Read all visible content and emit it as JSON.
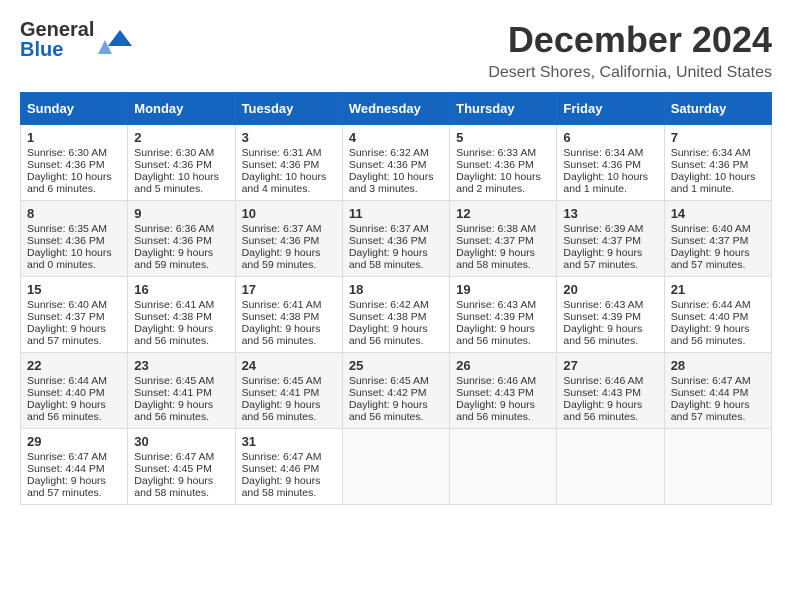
{
  "header": {
    "logo_line1": "General",
    "logo_line2": "Blue",
    "title": "December 2024",
    "subtitle": "Desert Shores, California, United States"
  },
  "weekdays": [
    "Sunday",
    "Monday",
    "Tuesday",
    "Wednesday",
    "Thursday",
    "Friday",
    "Saturday"
  ],
  "weeks": [
    [
      {
        "day": "1",
        "sunrise": "Sunrise: 6:30 AM",
        "sunset": "Sunset: 4:36 PM",
        "daylight": "Daylight: 10 hours and 6 minutes."
      },
      {
        "day": "2",
        "sunrise": "Sunrise: 6:30 AM",
        "sunset": "Sunset: 4:36 PM",
        "daylight": "Daylight: 10 hours and 5 minutes."
      },
      {
        "day": "3",
        "sunrise": "Sunrise: 6:31 AM",
        "sunset": "Sunset: 4:36 PM",
        "daylight": "Daylight: 10 hours and 4 minutes."
      },
      {
        "day": "4",
        "sunrise": "Sunrise: 6:32 AM",
        "sunset": "Sunset: 4:36 PM",
        "daylight": "Daylight: 10 hours and 3 minutes."
      },
      {
        "day": "5",
        "sunrise": "Sunrise: 6:33 AM",
        "sunset": "Sunset: 4:36 PM",
        "daylight": "Daylight: 10 hours and 2 minutes."
      },
      {
        "day": "6",
        "sunrise": "Sunrise: 6:34 AM",
        "sunset": "Sunset: 4:36 PM",
        "daylight": "Daylight: 10 hours and 1 minute."
      },
      {
        "day": "7",
        "sunrise": "Sunrise: 6:34 AM",
        "sunset": "Sunset: 4:36 PM",
        "daylight": "Daylight: 10 hours and 1 minute."
      }
    ],
    [
      {
        "day": "8",
        "sunrise": "Sunrise: 6:35 AM",
        "sunset": "Sunset: 4:36 PM",
        "daylight": "Daylight: 10 hours and 0 minutes."
      },
      {
        "day": "9",
        "sunrise": "Sunrise: 6:36 AM",
        "sunset": "Sunset: 4:36 PM",
        "daylight": "Daylight: 9 hours and 59 minutes."
      },
      {
        "day": "10",
        "sunrise": "Sunrise: 6:37 AM",
        "sunset": "Sunset: 4:36 PM",
        "daylight": "Daylight: 9 hours and 59 minutes."
      },
      {
        "day": "11",
        "sunrise": "Sunrise: 6:37 AM",
        "sunset": "Sunset: 4:36 PM",
        "daylight": "Daylight: 9 hours and 58 minutes."
      },
      {
        "day": "12",
        "sunrise": "Sunrise: 6:38 AM",
        "sunset": "Sunset: 4:37 PM",
        "daylight": "Daylight: 9 hours and 58 minutes."
      },
      {
        "day": "13",
        "sunrise": "Sunrise: 6:39 AM",
        "sunset": "Sunset: 4:37 PM",
        "daylight": "Daylight: 9 hours and 57 minutes."
      },
      {
        "day": "14",
        "sunrise": "Sunrise: 6:40 AM",
        "sunset": "Sunset: 4:37 PM",
        "daylight": "Daylight: 9 hours and 57 minutes."
      }
    ],
    [
      {
        "day": "15",
        "sunrise": "Sunrise: 6:40 AM",
        "sunset": "Sunset: 4:37 PM",
        "daylight": "Daylight: 9 hours and 57 minutes."
      },
      {
        "day": "16",
        "sunrise": "Sunrise: 6:41 AM",
        "sunset": "Sunset: 4:38 PM",
        "daylight": "Daylight: 9 hours and 56 minutes."
      },
      {
        "day": "17",
        "sunrise": "Sunrise: 6:41 AM",
        "sunset": "Sunset: 4:38 PM",
        "daylight": "Daylight: 9 hours and 56 minutes."
      },
      {
        "day": "18",
        "sunrise": "Sunrise: 6:42 AM",
        "sunset": "Sunset: 4:38 PM",
        "daylight": "Daylight: 9 hours and 56 minutes."
      },
      {
        "day": "19",
        "sunrise": "Sunrise: 6:43 AM",
        "sunset": "Sunset: 4:39 PM",
        "daylight": "Daylight: 9 hours and 56 minutes."
      },
      {
        "day": "20",
        "sunrise": "Sunrise: 6:43 AM",
        "sunset": "Sunset: 4:39 PM",
        "daylight": "Daylight: 9 hours and 56 minutes."
      },
      {
        "day": "21",
        "sunrise": "Sunrise: 6:44 AM",
        "sunset": "Sunset: 4:40 PM",
        "daylight": "Daylight: 9 hours and 56 minutes."
      }
    ],
    [
      {
        "day": "22",
        "sunrise": "Sunrise: 6:44 AM",
        "sunset": "Sunset: 4:40 PM",
        "daylight": "Daylight: 9 hours and 56 minutes."
      },
      {
        "day": "23",
        "sunrise": "Sunrise: 6:45 AM",
        "sunset": "Sunset: 4:41 PM",
        "daylight": "Daylight: 9 hours and 56 minutes."
      },
      {
        "day": "24",
        "sunrise": "Sunrise: 6:45 AM",
        "sunset": "Sunset: 4:41 PM",
        "daylight": "Daylight: 9 hours and 56 minutes."
      },
      {
        "day": "25",
        "sunrise": "Sunrise: 6:45 AM",
        "sunset": "Sunset: 4:42 PM",
        "daylight": "Daylight: 9 hours and 56 minutes."
      },
      {
        "day": "26",
        "sunrise": "Sunrise: 6:46 AM",
        "sunset": "Sunset: 4:43 PM",
        "daylight": "Daylight: 9 hours and 56 minutes."
      },
      {
        "day": "27",
        "sunrise": "Sunrise: 6:46 AM",
        "sunset": "Sunset: 4:43 PM",
        "daylight": "Daylight: 9 hours and 56 minutes."
      },
      {
        "day": "28",
        "sunrise": "Sunrise: 6:47 AM",
        "sunset": "Sunset: 4:44 PM",
        "daylight": "Daylight: 9 hours and 57 minutes."
      }
    ],
    [
      {
        "day": "29",
        "sunrise": "Sunrise: 6:47 AM",
        "sunset": "Sunset: 4:44 PM",
        "daylight": "Daylight: 9 hours and 57 minutes."
      },
      {
        "day": "30",
        "sunrise": "Sunrise: 6:47 AM",
        "sunset": "Sunset: 4:45 PM",
        "daylight": "Daylight: 9 hours and 58 minutes."
      },
      {
        "day": "31",
        "sunrise": "Sunrise: 6:47 AM",
        "sunset": "Sunset: 4:46 PM",
        "daylight": "Daylight: 9 hours and 58 minutes."
      },
      null,
      null,
      null,
      null
    ]
  ]
}
